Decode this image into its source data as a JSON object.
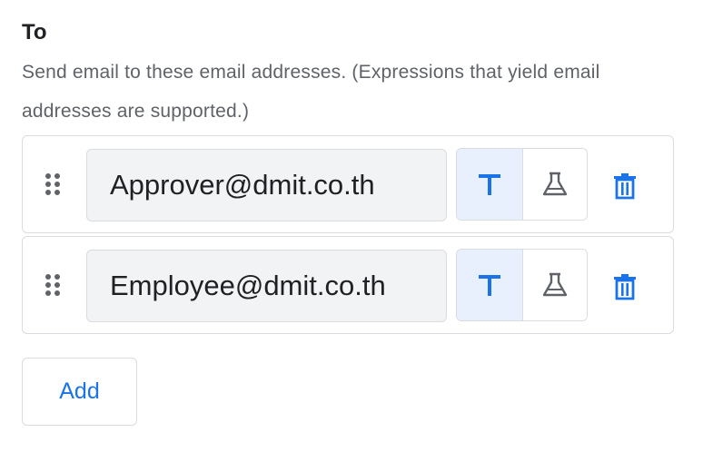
{
  "section": {
    "title": "To",
    "description": "Send email to these email addresses. (Expressions that yield email addresses are supported.)"
  },
  "recipients": [
    {
      "value": "Approver@dmit.co.th",
      "mode": "text"
    },
    {
      "value": "Employee@dmit.co.th",
      "mode": "text"
    }
  ],
  "add_label": "Add",
  "icons": {
    "drag": "drag-handle-icon",
    "text_mode": "text-format-icon",
    "expression_mode": "science-flask-icon",
    "delete": "trash-icon"
  },
  "colors": {
    "accent": "#1a73e8",
    "selected_bg": "#e8f0fe",
    "field_bg": "#f1f3f4",
    "border": "#dadce0",
    "muted_text": "#5f6368",
    "icon_gray": "#5f6368"
  }
}
